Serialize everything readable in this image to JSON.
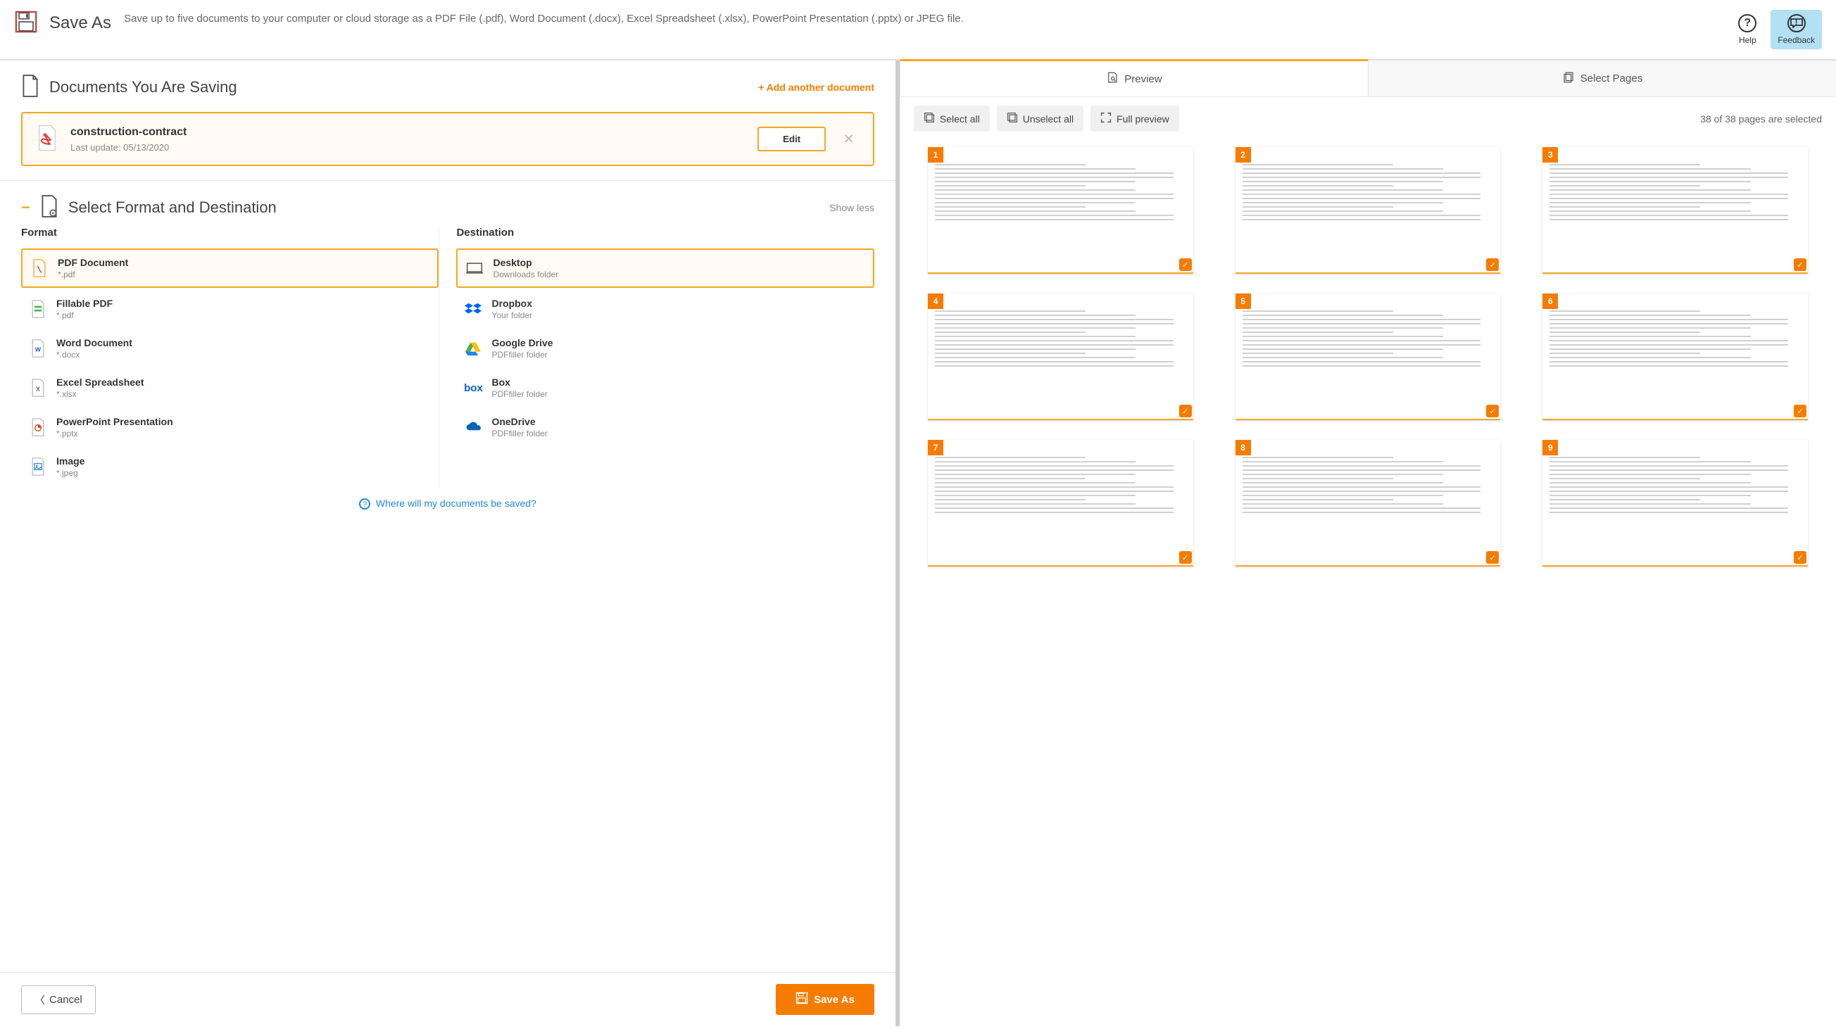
{
  "header": {
    "title": "Save As",
    "description": "Save up to five documents to your computer or cloud storage as a PDF File (.pdf), Word Document (.docx), Excel Spreadsheet (.xlsx), PowerPoint Presentation (.pptx) or JPEG file.",
    "help_label": "Help",
    "feedback_label": "Feedback"
  },
  "documents": {
    "heading": "Documents You Are Saving",
    "add_link": "+ Add another document",
    "item": {
      "name": "construction-contract",
      "meta": "Last update: 05/13/2020",
      "edit_label": "Edit"
    }
  },
  "select_section": {
    "heading": "Select Format and Destination",
    "toggle_label": "Show less",
    "format_label": "Format",
    "destination_label": "Destination",
    "help_link": "Where will my documents be saved?"
  },
  "formats": [
    {
      "name": "PDF Document",
      "ext": "*.pdf",
      "icon": "pdf",
      "selected": true
    },
    {
      "name": "Fillable PDF",
      "ext": "*.pdf",
      "icon": "fillable",
      "selected": false
    },
    {
      "name": "Word Document",
      "ext": "*.docx",
      "icon": "word",
      "selected": false
    },
    {
      "name": "Excel Spreadsheet",
      "ext": "*.xlsx",
      "icon": "excel",
      "selected": false
    },
    {
      "name": "PowerPoint Presentation",
      "ext": "*.pptx",
      "icon": "ppt",
      "selected": false
    },
    {
      "name": "Image",
      "ext": "*.jpeg",
      "icon": "image",
      "selected": false
    }
  ],
  "destinations": [
    {
      "name": "Desktop",
      "sub": "Downloads folder",
      "icon": "desktop",
      "selected": true
    },
    {
      "name": "Dropbox",
      "sub": "Your folder",
      "icon": "dropbox",
      "selected": false
    },
    {
      "name": "Google Drive",
      "sub": "PDFfiller folder",
      "icon": "gdrive",
      "selected": false
    },
    {
      "name": "Box",
      "sub": "PDFfiller folder",
      "icon": "box",
      "selected": false
    },
    {
      "name": "OneDrive",
      "sub": "PDFfiller folder",
      "icon": "onedrive",
      "selected": false
    }
  ],
  "footer": {
    "cancel_label": "Cancel",
    "save_label": "Save As"
  },
  "preview": {
    "tab_preview": "Preview",
    "tab_select": "Select Pages",
    "select_all": "Select all",
    "unselect_all": "Unselect all",
    "full_preview": "Full preview",
    "pages_info": "38 of 38 pages are selected",
    "total_pages": 38,
    "visible_pages": [
      1,
      2,
      3,
      4,
      5,
      6,
      7,
      8,
      9
    ]
  }
}
